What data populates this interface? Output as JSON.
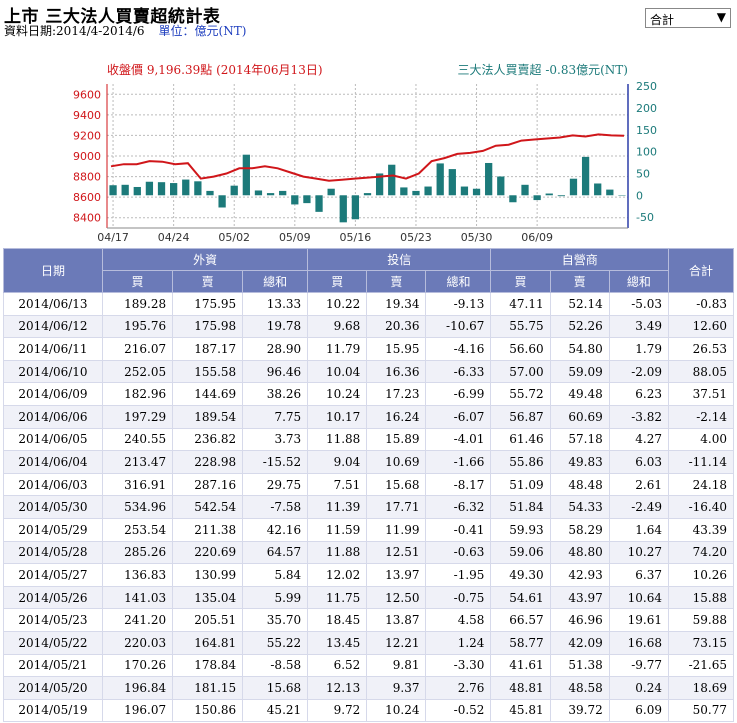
{
  "page": {
    "title": "上市 三大法人買賣超統計表",
    "date_range": "資料日期:2014/4-2014/6",
    "unit": "單位：億元(NT)",
    "select_value": "合計"
  },
  "chart_data": {
    "type": "bar+line",
    "left_label": "收盤價 9,196.39點 (2014年06月13日)",
    "right_label": "三大法人買賣超 -0.83億元(NT)",
    "left_axis": {
      "ticks": [
        9600,
        9400,
        9200,
        9000,
        8800,
        8600,
        8400
      ],
      "ylim": [
        8300,
        9700
      ]
    },
    "right_axis": {
      "ticks": [
        250,
        200,
        150,
        100,
        50,
        0,
        -50
      ],
      "ylim": [
        -75,
        255
      ]
    },
    "x_ticks": [
      "04/17",
      "04/24",
      "05/02",
      "05/09",
      "05/16",
      "05/23",
      "05/30",
      "06/09"
    ],
    "x_tick_index": [
      0,
      5,
      10,
      15,
      20,
      25,
      30,
      35
    ],
    "close": [
      8900,
      8920,
      8920,
      8950,
      8945,
      8920,
      8930,
      8780,
      8800,
      8830,
      8880,
      8880,
      8900,
      8880,
      8840,
      8800,
      8780,
      8760,
      8770,
      8780,
      8790,
      8800,
      8810,
      8780,
      8830,
      8950,
      8980,
      9020,
      9030,
      9050,
      9100,
      9110,
      9150,
      9160,
      9170,
      9180,
      9200,
      9190,
      9210,
      9200,
      9196.39
    ],
    "net": [
      23,
      24,
      19,
      31,
      30,
      28,
      36,
      32,
      10,
      -28,
      22,
      93,
      11,
      5,
      10,
      -21,
      -18,
      -38,
      15,
      -62,
      -55,
      5,
      50,
      70,
      18,
      10,
      20,
      73,
      60,
      20,
      15,
      74,
      43,
      -16,
      24,
      -11,
      4,
      -2,
      38,
      88,
      27,
      13,
      -1
    ],
    "series": [
      {
        "name": "收盤價",
        "color": "#d0161a"
      },
      {
        "name": "三大法人買賣超",
        "color": "#1c7a7a"
      }
    ]
  },
  "table": {
    "headers": {
      "date": "日期",
      "foreign": "外資",
      "trust": "投信",
      "dealer": "自營商",
      "total": "合計"
    },
    "sub": [
      "買",
      "賣",
      "總和",
      "買",
      "賣",
      "總和",
      "買",
      "賣",
      "總和"
    ],
    "rows": [
      [
        "2014/06/13",
        "189.28",
        "175.95",
        "13.33",
        "10.22",
        "19.34",
        "-9.13",
        "47.11",
        "52.14",
        "-5.03",
        "-0.83"
      ],
      [
        "2014/06/12",
        "195.76",
        "175.98",
        "19.78",
        "9.68",
        "20.36",
        "-10.67",
        "55.75",
        "52.26",
        "3.49",
        "12.60"
      ],
      [
        "2014/06/11",
        "216.07",
        "187.17",
        "28.90",
        "11.79",
        "15.95",
        "-4.16",
        "56.60",
        "54.80",
        "1.79",
        "26.53"
      ],
      [
        "2014/06/10",
        "252.05",
        "155.58",
        "96.46",
        "10.04",
        "16.36",
        "-6.33",
        "57.00",
        "59.09",
        "-2.09",
        "88.05"
      ],
      [
        "2014/06/09",
        "182.96",
        "144.69",
        "38.26",
        "10.24",
        "17.23",
        "-6.99",
        "55.72",
        "49.48",
        "6.23",
        "37.51"
      ],
      [
        "2014/06/06",
        "197.29",
        "189.54",
        "7.75",
        "10.17",
        "16.24",
        "-6.07",
        "56.87",
        "60.69",
        "-3.82",
        "-2.14"
      ],
      [
        "2014/06/05",
        "240.55",
        "236.82",
        "3.73",
        "11.88",
        "15.89",
        "-4.01",
        "61.46",
        "57.18",
        "4.27",
        "4.00"
      ],
      [
        "2014/06/04",
        "213.47",
        "228.98",
        "-15.52",
        "9.04",
        "10.69",
        "-1.66",
        "55.86",
        "49.83",
        "6.03",
        "-11.14"
      ],
      [
        "2014/06/03",
        "316.91",
        "287.16",
        "29.75",
        "7.51",
        "15.68",
        "-8.17",
        "51.09",
        "48.48",
        "2.61",
        "24.18"
      ],
      [
        "2014/05/30",
        "534.96",
        "542.54",
        "-7.58",
        "11.39",
        "17.71",
        "-6.32",
        "51.84",
        "54.33",
        "-2.49",
        "-16.40"
      ],
      [
        "2014/05/29",
        "253.54",
        "211.38",
        "42.16",
        "11.59",
        "11.99",
        "-0.41",
        "59.93",
        "58.29",
        "1.64",
        "43.39"
      ],
      [
        "2014/05/28",
        "285.26",
        "220.69",
        "64.57",
        "11.88",
        "12.51",
        "-0.63",
        "59.06",
        "48.80",
        "10.27",
        "74.20"
      ],
      [
        "2014/05/27",
        "136.83",
        "130.99",
        "5.84",
        "12.02",
        "13.97",
        "-1.95",
        "49.30",
        "42.93",
        "6.37",
        "10.26"
      ],
      [
        "2014/05/26",
        "141.03",
        "135.04",
        "5.99",
        "11.75",
        "12.50",
        "-0.75",
        "54.61",
        "43.97",
        "10.64",
        "15.88"
      ],
      [
        "2014/05/23",
        "241.20",
        "205.51",
        "35.70",
        "18.45",
        "13.87",
        "4.58",
        "66.57",
        "46.96",
        "19.61",
        "59.88"
      ],
      [
        "2014/05/22",
        "220.03",
        "164.81",
        "55.22",
        "13.45",
        "12.21",
        "1.24",
        "58.77",
        "42.09",
        "16.68",
        "73.15"
      ],
      [
        "2014/05/21",
        "170.26",
        "178.84",
        "-8.58",
        "6.52",
        "9.81",
        "-3.30",
        "41.61",
        "51.38",
        "-9.77",
        "-21.65"
      ],
      [
        "2014/05/20",
        "196.84",
        "181.15",
        "15.68",
        "12.13",
        "9.37",
        "2.76",
        "48.81",
        "48.58",
        "0.24",
        "18.69"
      ],
      [
        "2014/05/19",
        "196.07",
        "150.86",
        "45.21",
        "9.72",
        "10.24",
        "-0.52",
        "45.81",
        "39.72",
        "6.09",
        "50.77"
      ]
    ]
  }
}
